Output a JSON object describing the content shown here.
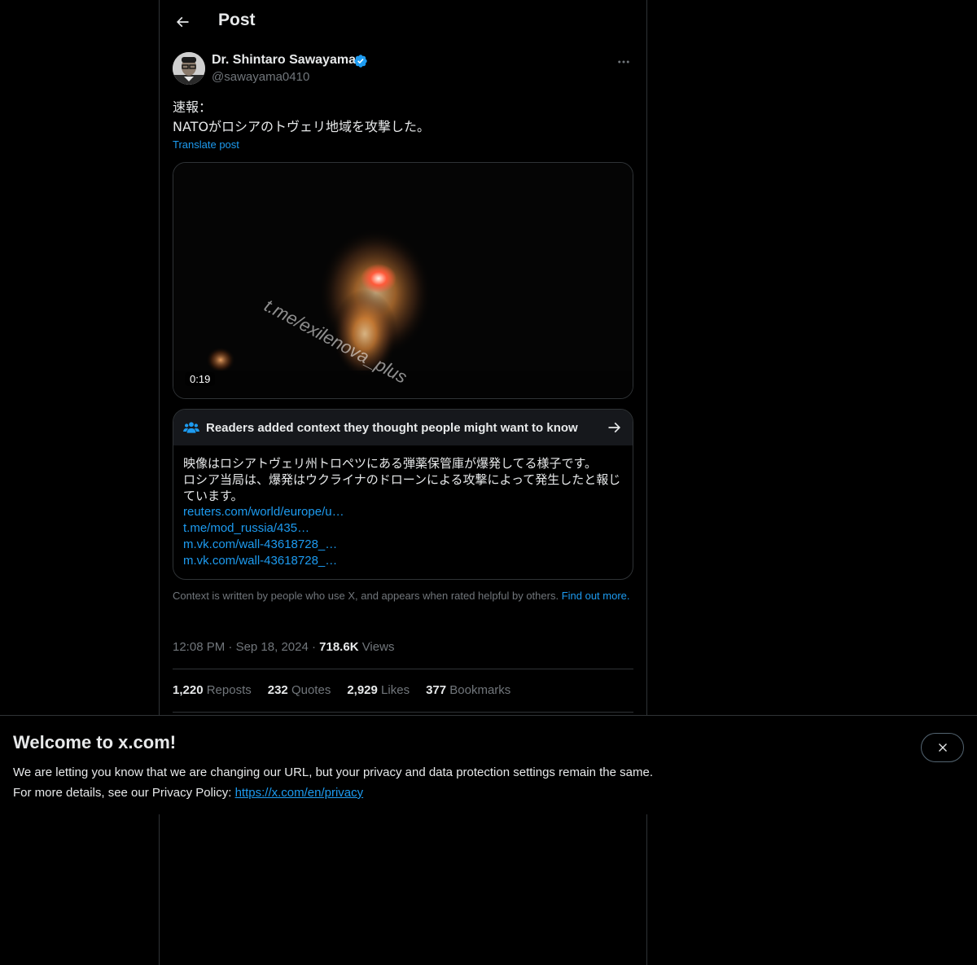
{
  "header": {
    "title": "Post",
    "back_icon": "arrow-left-icon"
  },
  "author": {
    "name": "Dr. Shintaro Sawayama",
    "handle": "@sawayama0410",
    "verified": true,
    "verified_color": "#1d9bf0"
  },
  "post": {
    "text_lines": [
      "速報：",
      "NATOがロシアのトヴェリ地域を攻撃した。"
    ],
    "translate_label": "Translate post",
    "media": {
      "duration": "0:19",
      "watermark": "t.me/exilenova_plus"
    }
  },
  "community_note": {
    "header_label": "Readers added context they thought people might want to know",
    "body_line1": "映像はロシアトヴェリ州トロペツにある弾薬保管庫が爆発してる様子です。",
    "body_line2": "ロシア当局は、爆発はウクライナのドローンによる攻撃によって発生したと報じています。",
    "links": [
      "reuters.com/world/europe/u…",
      "t.me/mod_russia/435…",
      "m.vk.com/wall-43618728_…",
      "m.vk.com/wall-43618728_…"
    ],
    "footer_text": "Context is written by people who use X, and appears when rated helpful by others.",
    "footer_link": "Find out more."
  },
  "meta": {
    "time": "12:08 PM",
    "separator": "·",
    "date": "Sep 18, 2024",
    "views_count": "718.6K",
    "views_label": "Views"
  },
  "stats": [
    {
      "count": "1,220",
      "label": "Reposts"
    },
    {
      "count": "232",
      "label": "Quotes"
    },
    {
      "count": "2,929",
      "label": "Likes"
    },
    {
      "count": "377",
      "label": "Bookmarks"
    }
  ],
  "banner": {
    "title": "Welcome to x.com!",
    "line1": "We are letting you know that we are changing our URL, but your privacy and data protection settings remain the same.",
    "line2_prefix": "For more details, see our Privacy Policy: ",
    "link": "https://x.com/en/privacy",
    "close_icon": "close-icon"
  },
  "colors": {
    "background": "#000000",
    "text": "#e7e9ea",
    "secondary": "#71767b",
    "link": "#1d9bf0",
    "border": "#2f3336"
  }
}
